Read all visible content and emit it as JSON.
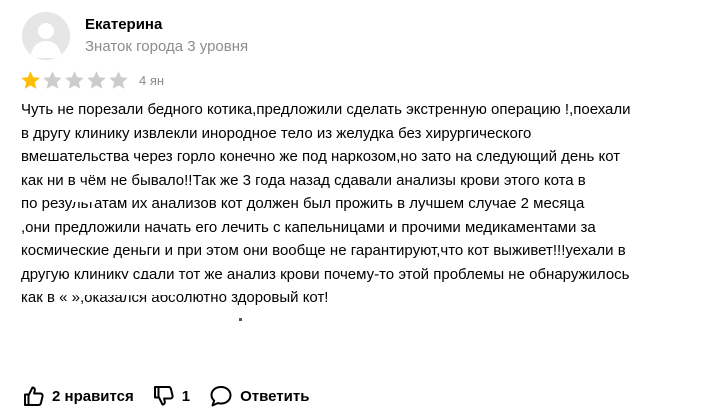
{
  "author": {
    "name": "Екатерина",
    "level": "Знаток города 3 уровня"
  },
  "rating": {
    "value": 1,
    "max": 5,
    "filled_color": "#fcbe08",
    "empty_color": "#cccccc"
  },
  "review": {
    "date": "4 ян",
    "text": "Чуть не порезали бедного котика,предложили сделать экстренную операцию !,поехали\nв другу клинику извлекли инородное тело из желудка без хирургического\nвмешательства через горло конечно же под наркозом,но зато на следующий день кот\nкак ни в чём не бывало!!Так же 3 года назад сдавали анализы крови этого кота в\n            по результатам их анализов кот должен был прожить в лучшем случае 2 месяца\n,они предложили начать его лечить с капельницами и прочими медикаментами за\nкосмические деньги и при этом они вообще не гарантируют,что кот выживет!!!уехали в\nдругую клинику сдали тот же анализ крови почему-то этой проблемы не обнаружилось\nкак в «                         »,оказался абсолютно здоровый кот!"
  },
  "actions": {
    "like_label": "2 нравится",
    "dislike_label": "1",
    "reply_label": "Ответить"
  },
  "icons": {
    "avatar": "avatar-placeholder-icon",
    "like": "thumbs-up-icon",
    "dislike": "thumbs-down-icon",
    "reply": "comment-bubble-icon"
  },
  "colors": {
    "secondary_text": "#8c8c8c",
    "avatar_bg": "#e6e6e6"
  }
}
